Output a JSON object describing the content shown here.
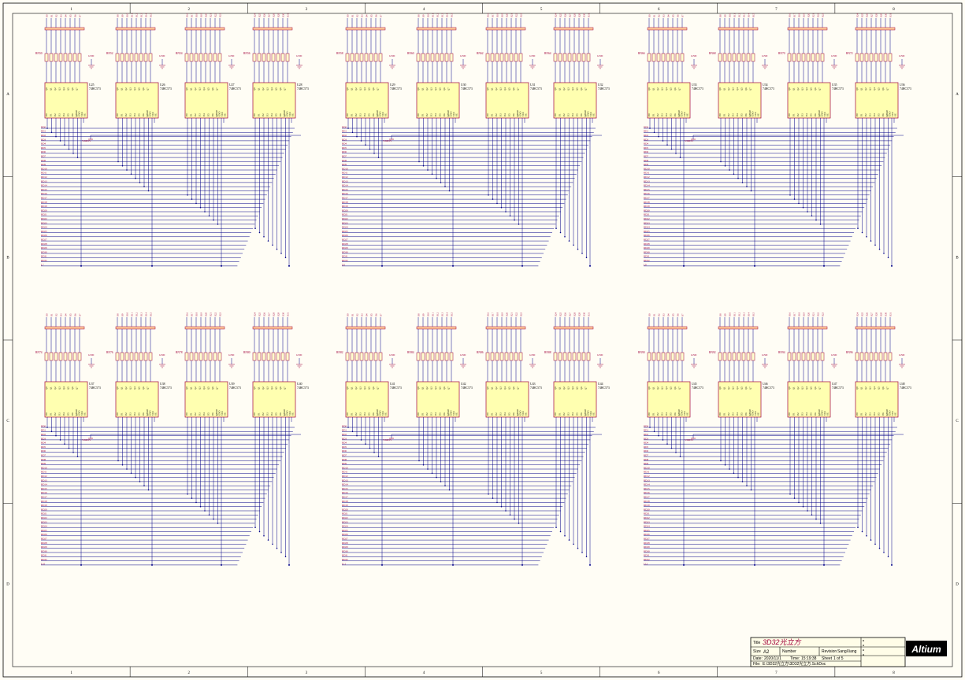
{
  "sheet": {
    "columns": [
      "1",
      "2",
      "3",
      "4",
      "5",
      "6",
      "7",
      "8"
    ],
    "rows": [
      "A",
      "B",
      "C",
      "D"
    ]
  },
  "chip_type": "74HC573",
  "chip_labels": [
    "U25",
    "U26",
    "U27",
    "U28",
    "U29",
    "U30",
    "U31",
    "U32",
    "U33",
    "U34",
    "U35",
    "U36",
    "U37",
    "U38",
    "U39",
    "U40",
    "U41",
    "U42",
    "U43",
    "U44",
    "U45",
    "U46",
    "U47",
    "U48"
  ],
  "resistor_labels": [
    "RN50",
    "RN52",
    "RN54",
    "RN56",
    "RN58",
    "RN60",
    "RN62",
    "RN64",
    "RN66",
    "RN68",
    "RN70",
    "RN72",
    "RN74",
    "RN76",
    "RN78",
    "RN80",
    "RN82",
    "RN84",
    "RN86",
    "RN88",
    "RN90",
    "RN92",
    "RN94",
    "RN96"
  ],
  "chip_pins": {
    "top": [
      "Q0",
      "Q1",
      "Q2",
      "Q3",
      "Q4",
      "Q5",
      "Q6",
      "Q7"
    ],
    "bottom": [
      "D0",
      "D1",
      "D2",
      "D3",
      "D4",
      "D5",
      "D6",
      "D7"
    ],
    "right": [
      "LOAD",
      "GND",
      "VCC",
      "OE"
    ]
  },
  "power": {
    "gnd": "GND",
    "vdd": "VDD5V"
  },
  "groups": [
    {
      "bus": "RD",
      "latch": "L7"
    },
    {
      "bus": "RD",
      "latch": "L8"
    },
    {
      "bus": "RD",
      "latch": "L9"
    },
    {
      "bus": "RD",
      "latch": "L10"
    },
    {
      "bus": "RD",
      "latch": "L11"
    },
    {
      "bus": "RD",
      "latch": "L12"
    }
  ],
  "title_block": {
    "title_label": "Title",
    "title_value": "3D32光立方",
    "size_label": "Size",
    "size_value": "A2",
    "number_label": "Number",
    "revision_label": "Revision",
    "revision_value": "SangXiang",
    "date_label": "Date:",
    "date_value": "2020/11/1",
    "time_label": "Time:",
    "time_value": "15:19:38",
    "sheet_label": "Sheet",
    "sheet_of": "1 of 5",
    "file_label": "File:",
    "file_value": "E:\\3D32光立方\\3D32光立方.SchDoc",
    "logo": "Altium"
  }
}
